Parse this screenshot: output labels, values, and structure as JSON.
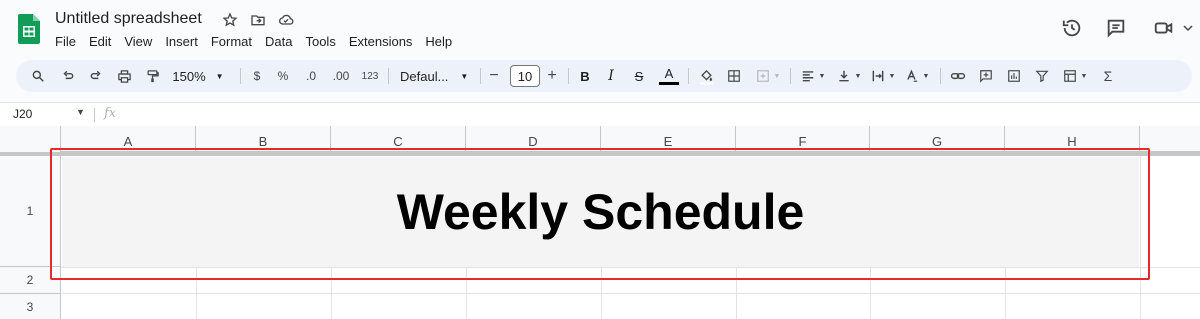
{
  "window": {
    "doc_title": "Untitled spreadsheet",
    "menu": [
      "File",
      "Edit",
      "View",
      "Insert",
      "Format",
      "Data",
      "Tools",
      "Extensions",
      "Help"
    ]
  },
  "toolbar": {
    "zoom": "150%",
    "currency": "$",
    "percent": "%",
    "decrease_decimal": ".0",
    "increase_decimal": ".00",
    "number_format": "123",
    "font": "Defaul...",
    "font_size": "10",
    "minus": "−",
    "plus": "+",
    "bold": "B",
    "italic": "I",
    "strike": "S",
    "text_color": "A",
    "sum": "Σ"
  },
  "formula_bar": {
    "name_box": "J20",
    "fx": "fx",
    "formula": ""
  },
  "grid": {
    "columns": [
      "A",
      "B",
      "C",
      "D",
      "E",
      "F",
      "G",
      "H"
    ],
    "rows": [
      "1",
      "2",
      "3"
    ],
    "merged_cell_text": "Weekly Schedule"
  },
  "colors": {
    "accent": "#0b57d0",
    "highlight_border": "#e8282b",
    "toolbar_bg": "#edf2fa",
    "sheets_green": "#0f9d58"
  }
}
